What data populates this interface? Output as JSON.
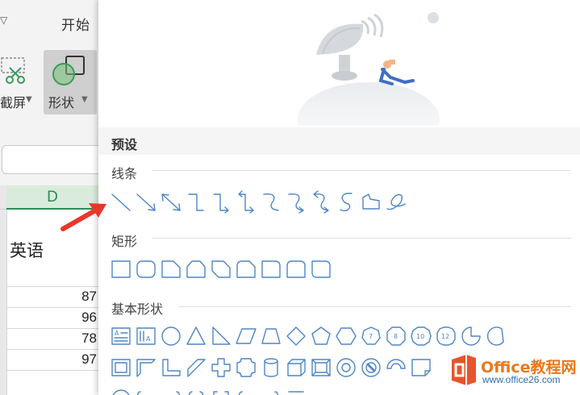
{
  "toolbar": {
    "start_tab": "开始",
    "screenshot_label": "截屏",
    "shapes_label": "形状"
  },
  "sheet": {
    "column_label": "D",
    "header_cell": "英语",
    "scores": [
      "87",
      "96",
      "78",
      "97"
    ]
  },
  "panel": {
    "title": "预设",
    "sections": {
      "lines": "线条",
      "rectangles": "矩形",
      "basic": "基本形状"
    },
    "shape_icons": {
      "lines": [
        "line-icon",
        "arrow-line-icon",
        "double-arrow-line-icon",
        "elbow-connector-icon",
        "elbow-arrow-connector-icon",
        "elbow-double-arrow-connector-icon",
        "curved-connector-icon",
        "curved-arrow-connector-icon",
        "curved-double-arrow-connector-icon",
        "curve-icon",
        "freeform-icon",
        "scribble-icon"
      ],
      "rectangles": [
        "rectangle-icon",
        "rounded-rectangle-icon",
        "snip-single-corner-rectangle-icon",
        "snip-same-side-corner-rectangle-icon",
        "snip-diagonal-corner-rectangle-icon",
        "snip-round-rectangle-icon",
        "round-single-corner-rectangle-icon",
        "round-same-side-corner-rectangle-icon",
        "round-diagonal-corner-rectangle-icon"
      ],
      "basic_row1": [
        "text-box-icon",
        "vertical-text-box-icon",
        "oval-icon",
        "triangle-icon",
        "right-triangle-icon",
        "parallelogram-icon",
        "trapezoid-icon",
        "diamond-icon",
        "pentagon-icon",
        "hexagon-icon",
        "heptagon-icon",
        "octagon-icon",
        "decagon-icon",
        "dodecagon-icon",
        "pie-icon",
        "chord-icon"
      ],
      "basic_row2": [
        "frame-icon",
        "half-frame-icon",
        "l-shape-icon",
        "diagonal-stripe-icon",
        "cross-icon",
        "plaque-icon",
        "can-icon",
        "cube-icon",
        "bevel-icon",
        "donut-icon",
        "no-symbol-icon",
        "block-arc-icon",
        "folded-corner-icon"
      ]
    },
    "polygon_labels": {
      "heptagon": "7",
      "octagon": "8",
      "decagon": "10",
      "dodecagon": "12"
    }
  },
  "colors": {
    "accent": "#4f86c6",
    "selected_column": "#2e8b57",
    "arrow": "#e8372a",
    "watermark_orange": "#e8791b"
  },
  "watermark": {
    "text": "Office教程网",
    "url": "www.office26.com"
  }
}
